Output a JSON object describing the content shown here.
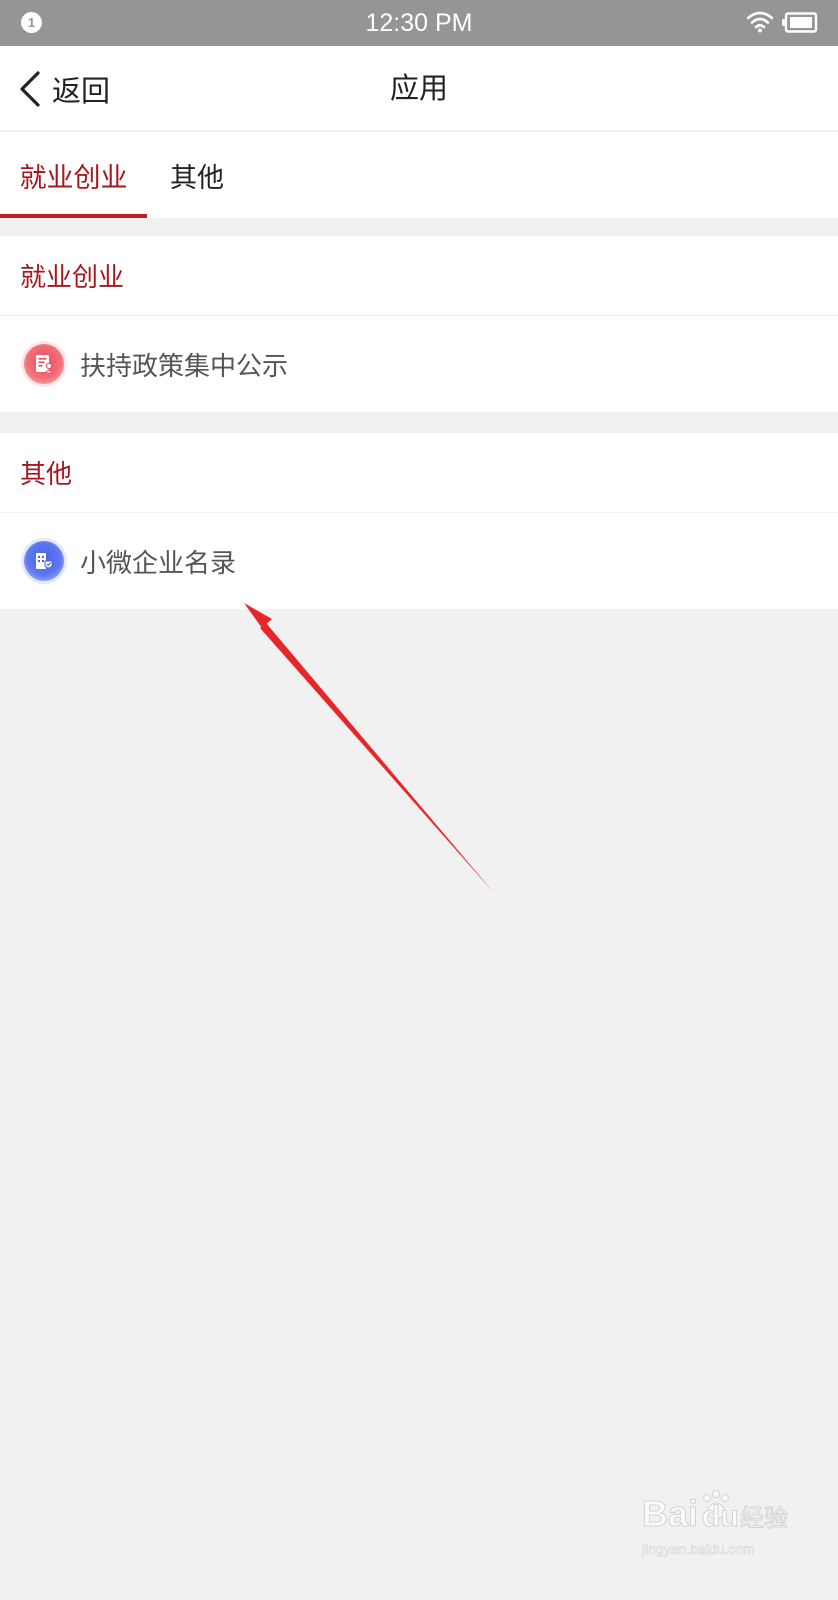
{
  "status_bar": {
    "notification_count": "1",
    "time": "12:30 PM",
    "icons": [
      "wifi-icon",
      "battery-icon"
    ]
  },
  "nav": {
    "back_label": "返回",
    "title": "应用",
    "back_icon": "chevron-left-icon"
  },
  "tabs": [
    {
      "label": "就业创业",
      "active": true
    },
    {
      "label": "其他",
      "active": false
    }
  ],
  "sections": [
    {
      "title": "就业创业",
      "items": [
        {
          "label": "扶持政策集中公示",
          "icon": "policy-document-icon",
          "icon_color": "#ef4b57"
        }
      ]
    },
    {
      "title": "其他",
      "items": [
        {
          "label": "小微企业名录",
          "icon": "enterprise-directory-icon",
          "icon_color": "#4a63e6"
        }
      ]
    }
  ],
  "colors": {
    "accent": "#a8171d",
    "tab_underline": "#bf1e24",
    "status_bar": "#959595",
    "page_background": "#f1f1f2",
    "annotation_arrow": "#e8262a"
  },
  "watermark": {
    "brand": "Bai",
    "brand_suffix": "du",
    "product": "经验",
    "url": "jingyan.baidu.com"
  }
}
